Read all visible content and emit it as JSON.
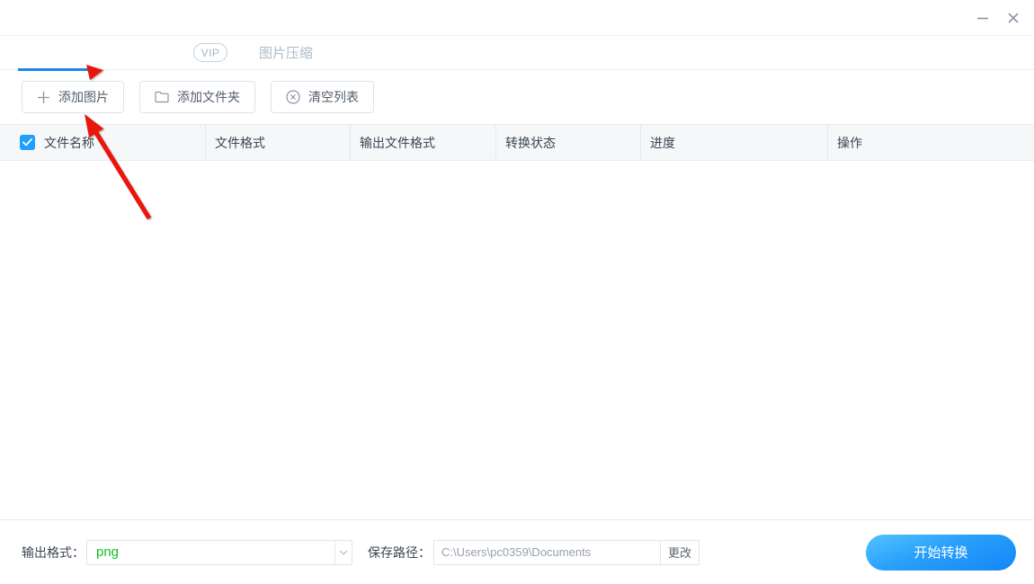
{
  "window": {
    "minimize_icon": "minimize-dash",
    "close_icon": "close-x"
  },
  "tabs": {
    "vip_badge": "VIP",
    "compress_tab": "图片压缩",
    "active_tab_underline_color": "#1b87e6"
  },
  "toolbar": {
    "add_image": "添加图片",
    "add_folder": "添加文件夹",
    "clear_list": "清空列表"
  },
  "table": {
    "headers": [
      "文件名称",
      "文件格式",
      "输出文件格式",
      "转换状态",
      "进度",
      "操作"
    ],
    "select_all_checked": true,
    "rows": []
  },
  "footer": {
    "output_format_label": "输出格式：",
    "output_format_value": "png",
    "save_path_label": "保存路径：",
    "save_path_value": "C:\\Users\\pc0359\\Documents",
    "change_button": "更改",
    "start_button": "开始转换"
  },
  "colors": {
    "accent_blue": "#1b87e6",
    "checkbox_blue": "#1ea0ff",
    "format_green": "#13bd29",
    "annotation_red": "#e9120d",
    "start_button_gradient_top": "#55c2ff",
    "start_button_gradient_bottom": "#1486f7"
  },
  "icons": {
    "plus": "+",
    "folder": "folder-outline",
    "clear": "circle-x",
    "chevron": "chevron-down",
    "check": "checkmark"
  }
}
